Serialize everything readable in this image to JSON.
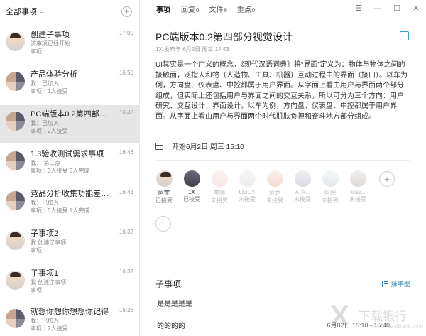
{
  "sidebar": {
    "title": "全部事项",
    "items": [
      {
        "title": "创建子事项",
        "time": "17:00",
        "line1": "该事项已经开始",
        "line2": "事项",
        "line3": ""
      },
      {
        "title": "产品体验分析",
        "time": "16:50",
        "line1": "我：已加入",
        "line2": "事项",
        "line3": "1人接受"
      },
      {
        "title": "PC端版本0.2第四部分视觉...",
        "time": "16:48",
        "line1": "我：已加入",
        "line2": "事项",
        "line3": "2人接受"
      },
      {
        "title": "1.3验收测试需求事项",
        "time": "16:46",
        "line1": "我： 第三点",
        "line2": "事项",
        "line3": "3人接受 3人完成"
      },
      {
        "title": "竞品分析收集功能差异化",
        "time": "16:43",
        "line1": "我：已加入",
        "line2": "事项",
        "line3": "5人接受 1人完成"
      },
      {
        "title": "子事项2",
        "time": "16:32",
        "line1": "我 创建了事项",
        "line2": "事项",
        "line3": ""
      },
      {
        "title": "子事项1",
        "time": "16:32",
        "line1": "我 创建了事项",
        "line2": "事项",
        "line3": ""
      },
      {
        "title": "就想你想你想想你记得",
        "time": "16:26",
        "line1": "我：已加入",
        "line2": "事项",
        "line3": "2人接受"
      }
    ]
  },
  "tabs": [
    {
      "label": "事项",
      "count": ""
    },
    {
      "label": "回复",
      "count": "0"
    },
    {
      "label": "文件",
      "count": "6"
    },
    {
      "label": "重点",
      "count": "0"
    }
  ],
  "task": {
    "title": "PC端版本0.2第四部分视觉设计",
    "meta": "1X 发布于 6月2日 周三 14:43",
    "description": "UI其实是一个广义的概念，《现代汉语词典》将“界面”定义为：物体与物体之间的接触面，泛指人和物（人造物、工具、机器）互动过程中的界面（接口）。以车为例，方向盘、仪表盘、中控都属于用户界面。从字面上看由用户与界面两个部分组成，但实际上还包括用户与界面之间的交互关系，所以可分为三个方向：用户研究、交互设计、界面设计。以车为例，方向盘、仪表盘、中控都属于用户界面。从字面上看由用户与界面两个时代肌肤负担和奋斗地方部分组成。",
    "start": "开始6月2日 周三 15:10"
  },
  "members": [
    {
      "name": "阿宇",
      "status": "已接受",
      "accepted": true
    },
    {
      "name": "1X",
      "status": "已接受",
      "accepted": true
    },
    {
      "name": "李圆",
      "status": "未接受",
      "accepted": false
    },
    {
      "name": "LEICY",
      "status": "未接受",
      "accepted": false
    },
    {
      "name": "阿龙",
      "status": "未接受",
      "accepted": false
    },
    {
      "name": "ATA...",
      "status": "未接受",
      "accepted": false
    },
    {
      "name": "阿肥",
      "status": "未接受",
      "accepted": false
    },
    {
      "name": "Mas...",
      "status": "未接受",
      "accepted": false
    }
  ],
  "subtasks": {
    "header": "子事项",
    "mindmap_label": "脉络图",
    "items": [
      "是是是是是",
      "的的的的"
    ],
    "time": "6月02日 15:10 - 15:40"
  },
  "watermark": {
    "text": "下载银行",
    "url": "www.xiazaiBank.com"
  }
}
